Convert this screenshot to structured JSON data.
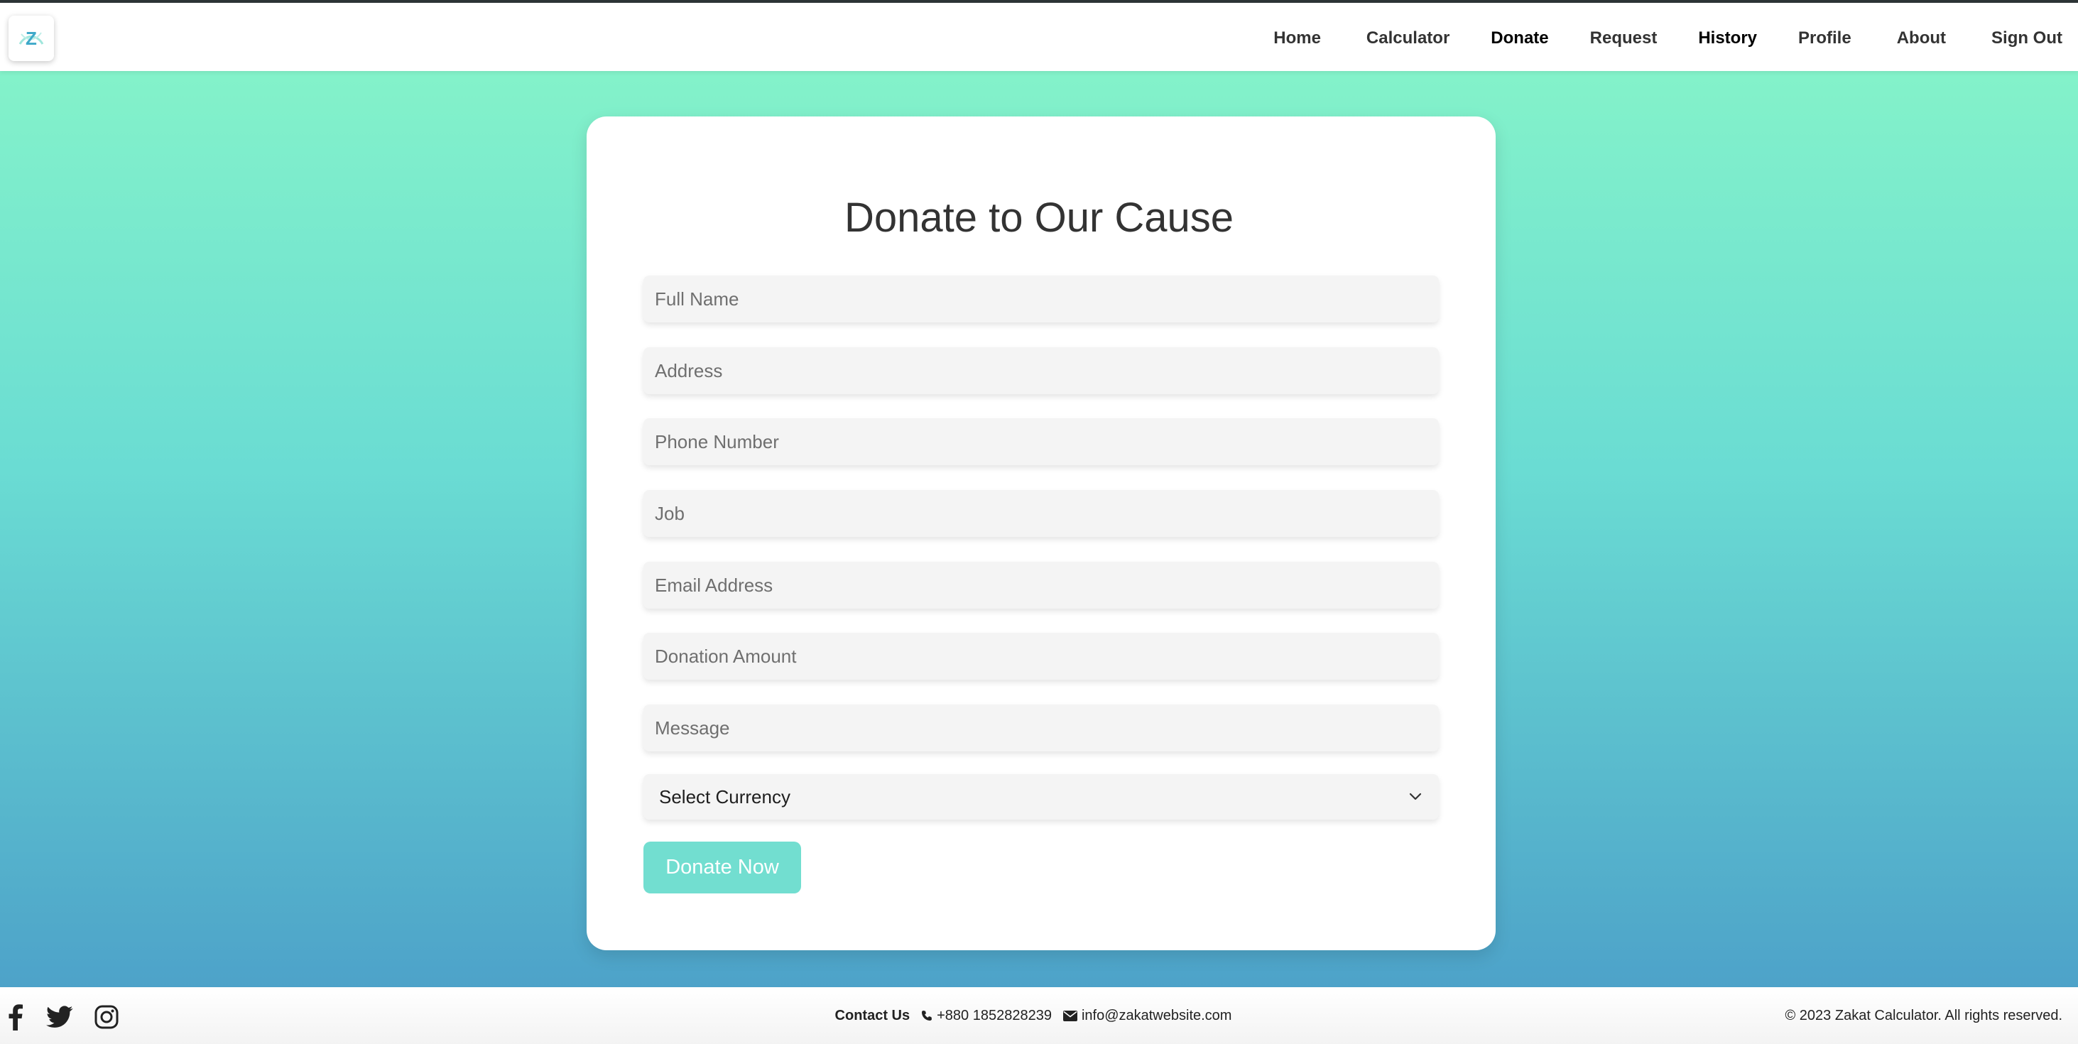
{
  "header": {
    "logo_letter": "Z",
    "nav": [
      {
        "label": "Home"
      },
      {
        "label": "Calculator"
      },
      {
        "label": "Donate"
      },
      {
        "label": "Request"
      },
      {
        "label": "History"
      },
      {
        "label": "Profile"
      },
      {
        "label": "About"
      },
      {
        "label": "Sign Out"
      }
    ]
  },
  "form": {
    "title": "Donate to Our Cause",
    "fields": {
      "full_name": {
        "value": "",
        "placeholder": "Full Name"
      },
      "address": {
        "value": "",
        "placeholder": "Address"
      },
      "phone": {
        "value": "",
        "placeholder": "Phone Number"
      },
      "job": {
        "value": "",
        "placeholder": "Job"
      },
      "email": {
        "value": "",
        "placeholder": "Email Address"
      },
      "amount": {
        "value": "",
        "placeholder": "Donation Amount"
      },
      "message": {
        "value": "",
        "placeholder": "Message"
      }
    },
    "currency": {
      "selected": "Select Currency"
    },
    "submit_label": "Donate Now"
  },
  "footer": {
    "social_icons": [
      "facebook-icon",
      "twitter-icon",
      "instagram-icon"
    ],
    "contact_label": "Contact Us",
    "phone": "+880 1852828239",
    "email": "info@zakatwebsite.com",
    "copyright": "© 2023 Zakat Calculator. All rights reserved."
  },
  "colors": {
    "gradient_top": "#88f6c8",
    "gradient_bottom": "#4a9cc8",
    "button": "#72ded0",
    "field_bg": "#f4f4f4"
  }
}
